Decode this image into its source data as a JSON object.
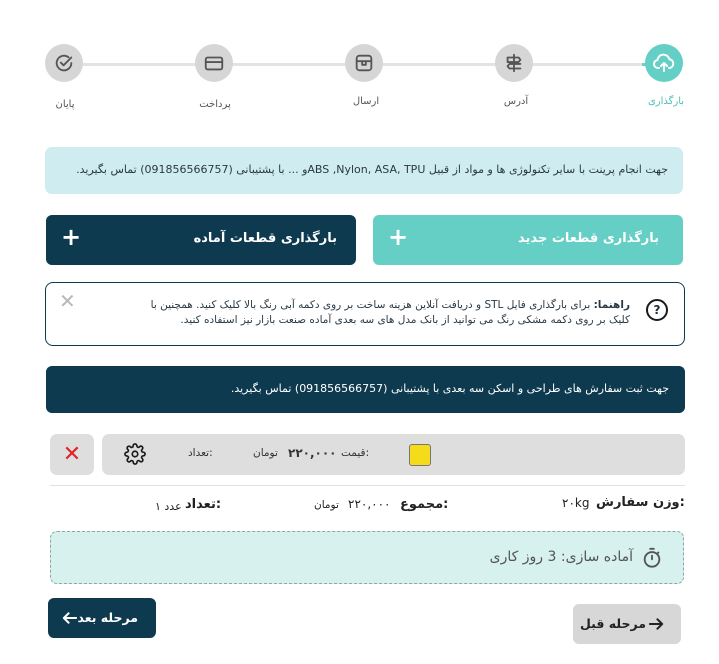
{
  "stepper": {
    "steps": [
      {
        "label": "بارگذاری",
        "icon": "cloud-upload-icon",
        "active": true
      },
      {
        "label": "آدرس",
        "icon": "signpost-icon",
        "active": false
      },
      {
        "label": "ارسال",
        "icon": "box-icon",
        "active": false
      },
      {
        "label": "پرداخت",
        "icon": "credit-card-icon",
        "active": false
      },
      {
        "label": "پایان",
        "icon": "check-circle-icon",
        "active": false
      }
    ]
  },
  "info_banner": "جهت انجام پرینت با سایر تکنولوژی ها و مواد از قبیل ABS ,Nylon, ASA, TPUو ... با پشتیبانی (091856566757) تماس بگیرید.",
  "actions": {
    "upload_new_label": "بارگذاری قطعات جدید",
    "upload_ready_label": "بارگذاری قطعات آماده"
  },
  "guide": {
    "title": "راهنما:",
    "text": " برای بارگذاری فایل STL و دریافت آنلاین هزینه ساخت بر روی دکمه آبی رنگ بالا کلیک کنید. همچنین با کلیک بر روی دکمه مشکی رنگ می توانید از بانک مدل های سه بعدی آماده صنعت بازار نیز استفاده کنید.",
    "help_symbol": "?",
    "close_symbol": "✕"
  },
  "contact_bar": "جهت ثبت سفارش های طراحی و اسکن سه بعدی با پشتیبانی (091856566757) تماس بگیرید.",
  "item": {
    "color": "#f5dc1a",
    "price_label": "قیمت:",
    "price_value": "۲۲۰,۰۰۰",
    "price_unit": "تومان",
    "quantity_label": "تعداد:",
    "delete_symbol": "✕"
  },
  "summary": {
    "weight_label": "وزن سفارش:",
    "weight_value": "۲۰kg",
    "total_label": "مجموع:",
    "total_value": "۲۲۰,۰۰۰",
    "total_unit": "تومان",
    "count_label": "تعداد:",
    "count_value": "۱ عدد"
  },
  "preparation": "آماده سازی: 3 روز کاری",
  "nav": {
    "next_label": "مرحله بعد",
    "prev_label": "مرحله قبل"
  },
  "colors": {
    "primary_dark": "#0e3a50",
    "accent_teal": "#66cfc5",
    "delete_red": "#e0242a"
  }
}
